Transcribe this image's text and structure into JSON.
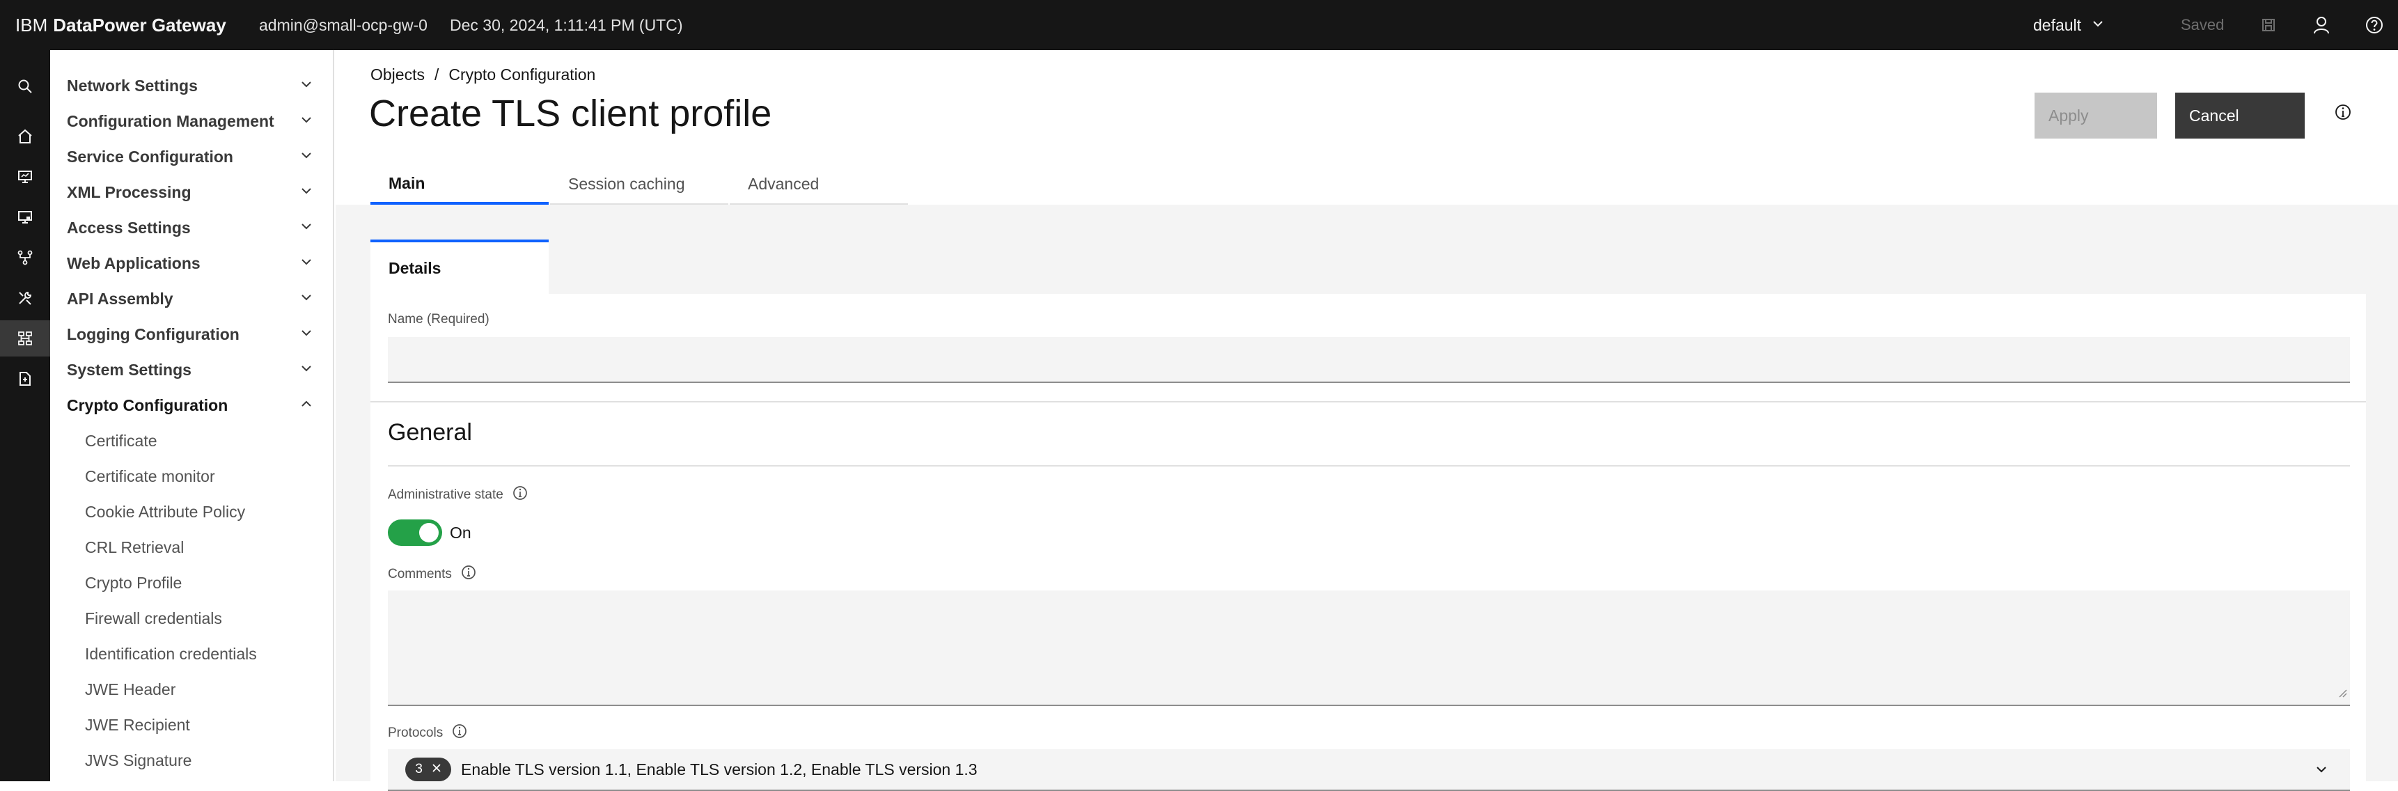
{
  "header": {
    "brand_prefix": "IBM",
    "brand_name": "DataPower Gateway",
    "user": "admin@small-ocp-gw-0",
    "datetime": "Dec 30, 2024, 1:11:41 PM (UTC)",
    "domain": "default",
    "saved_label": "Saved"
  },
  "rail": {
    "icons": [
      "search-icon",
      "home-icon",
      "monitor-icon",
      "computer-icon",
      "network-icon",
      "tools-icon",
      "objects-icon",
      "files-icon"
    ],
    "active_index": 6
  },
  "nav": {
    "groups": [
      {
        "label": "Network Settings"
      },
      {
        "label": "Configuration Management"
      },
      {
        "label": "Service Configuration"
      },
      {
        "label": "XML Processing"
      },
      {
        "label": "Access Settings"
      },
      {
        "label": "Web Applications"
      },
      {
        "label": "API Assembly"
      },
      {
        "label": "Logging Configuration"
      },
      {
        "label": "System Settings"
      },
      {
        "label": "Crypto Configuration"
      }
    ],
    "crypto_items": [
      {
        "label": "Certificate"
      },
      {
        "label": "Certificate monitor"
      },
      {
        "label": "Cookie Attribute Policy"
      },
      {
        "label": "CRL Retrieval"
      },
      {
        "label": "Crypto Profile"
      },
      {
        "label": "Firewall credentials"
      },
      {
        "label": "Identification credentials"
      },
      {
        "label": "JWE Header"
      },
      {
        "label": "JWE Recipient"
      },
      {
        "label": "JWS Signature"
      }
    ]
  },
  "breadcrumb": {
    "items": [
      {
        "label": "Objects"
      },
      {
        "label": "Crypto Configuration"
      }
    ],
    "separator": "/"
  },
  "page": {
    "title": "Create TLS client profile",
    "apply_label": "Apply",
    "cancel_label": "Cancel"
  },
  "tabs": [
    {
      "label": "Main",
      "active": true
    },
    {
      "label": "Session caching",
      "active": false
    },
    {
      "label": "Advanced",
      "active": false
    }
  ],
  "subtab": {
    "label": "Details"
  },
  "form": {
    "name_label": "Name (Required)",
    "name_value": "",
    "general_title": "General",
    "admin_state_label": "Administrative state",
    "admin_state_value": "On",
    "comments_label": "Comments",
    "comments_value": "",
    "protocols_label": "Protocols",
    "protocols_count": "3",
    "protocols_value": "Enable TLS version 1.1, Enable TLS version 1.2, Enable TLS version 1.3"
  },
  "colors": {
    "header_bg": "#161616",
    "accent": "#0f62fe",
    "toggle_on": "#24a148",
    "secondary_button": "#393939",
    "disabled_button": "#c6c6c6"
  }
}
